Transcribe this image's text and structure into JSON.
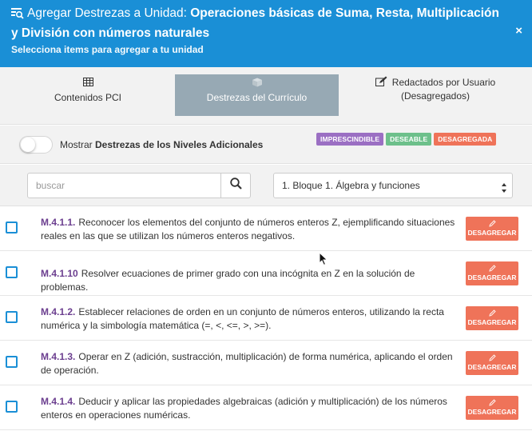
{
  "header": {
    "title_prefix": "Agregar Destrezas a Unidad: ",
    "title_strong": "Operaciones básicas de Suma, Resta, Multiplicación y División con números naturales",
    "subtitle": "Selecciona items para agregar a tu unidad",
    "close": "×",
    "icon": "search-list-icon"
  },
  "tabs": [
    {
      "label": "Contenidos PCI",
      "icon": "table-icon",
      "active": false
    },
    {
      "label": "Destrezas del Currículo",
      "icon": "box-icon",
      "active": true
    },
    {
      "label_line1": "Redactados por Usuario",
      "label_line2": "(Desagregados)",
      "icon": "edit-icon",
      "active": false
    }
  ],
  "toggle": {
    "label_prefix": "Mostrar ",
    "label_strong": "Destrezas de los Niveles Adicionales",
    "on": false
  },
  "badges": [
    {
      "label": "IMPRESCINDIBLE",
      "color": "#9b6fc3"
    },
    {
      "label": "DESEABLE",
      "color": "#6dc08b"
    },
    {
      "label": "DESAGREGADA",
      "color": "#ef7359"
    }
  ],
  "search": {
    "placeholder": "buscar",
    "value": ""
  },
  "select": {
    "value": "1. Bloque 1. Álgebra y funciones"
  },
  "items": [
    {
      "code": "M.4.1.1.",
      "text": "Reconocer los elementos del conjunto de números enteros Z, ejemplificando situaciones reales en las que se utilizan los números enteros negativos.",
      "button": "DESAGREGAR"
    },
    {
      "code": "M.4.1.10",
      "text": "Resolver ecuaciones de primer grado con una incógnita en Z en la solución de problemas.",
      "button": "DESAGREGAR"
    },
    {
      "code": "M.4.1.2.",
      "text": "Establecer relaciones de orden en un conjunto de números enteros, utilizando la recta numérica y la simbología matemática (=, <, <=, >, >=).",
      "button": "DESAGREGAR"
    },
    {
      "code": "M.4.1.3.",
      "text": "Operar en Z (adición, sustracción, multiplicación) de forma numérica, aplicando el orden de operación.",
      "button": "DESAGREGAR"
    },
    {
      "code": "M.4.1.4.",
      "text": "Deducir y aplicar las propiedades algebraicas (adición y multiplicación) de los números enteros en operaciones numéricas.",
      "button": "DESAGREGAR"
    }
  ],
  "colors": {
    "header": "#1a8fd6",
    "active_tab": "#97a9b4",
    "code": "#6b3e8f",
    "button": "#ef7359"
  }
}
